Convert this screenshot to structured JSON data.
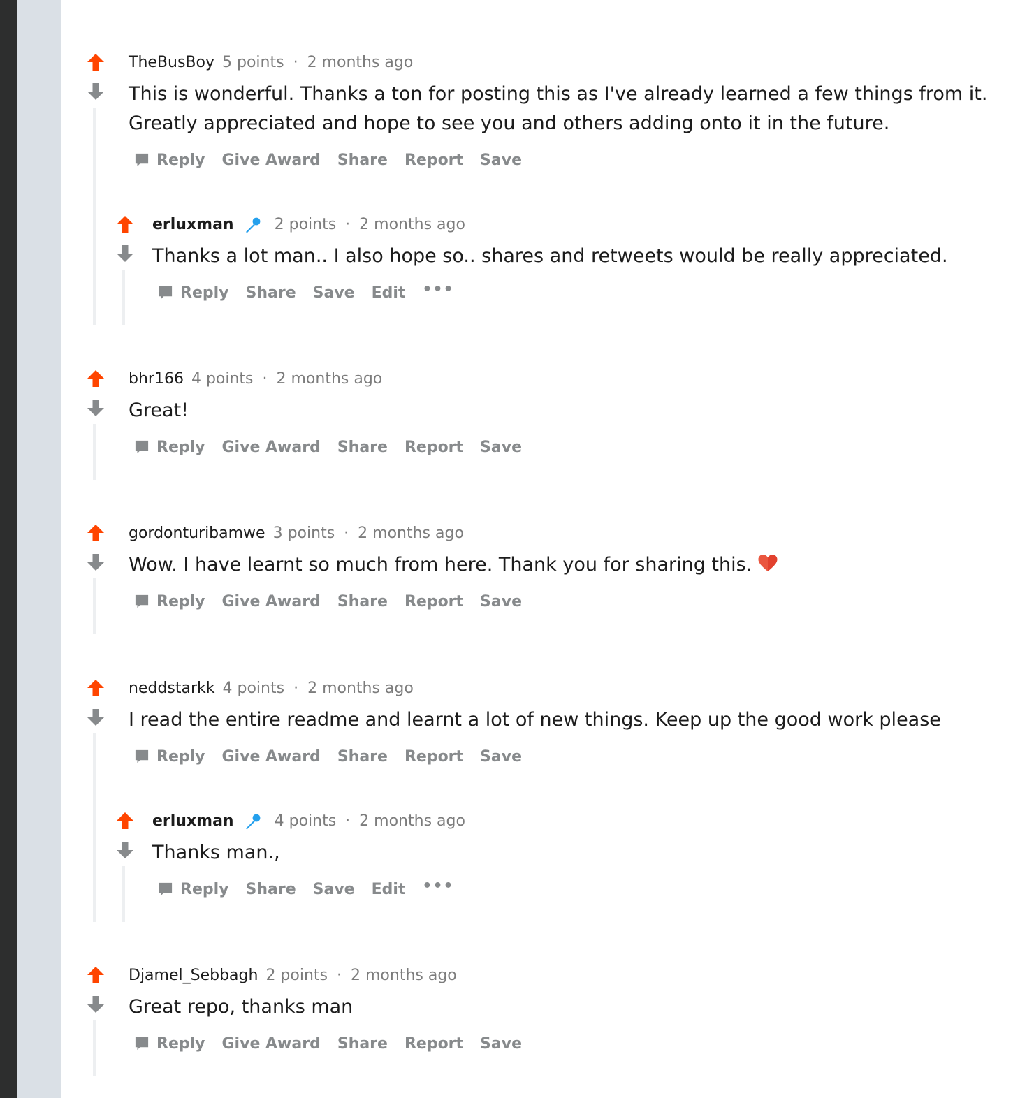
{
  "colors": {
    "upvote": "#ff4500",
    "downvote": "#878a8c",
    "mic_badge": "#24a0ed",
    "heart": "#e2412e",
    "meta_gray": "#7c7c7c",
    "action_gray": "#878a8c"
  },
  "comments": [
    {
      "author": "TheBusBoy",
      "points": "5 points",
      "separator": "·",
      "time": "2 months ago",
      "text": "This is wonderful. Thanks a ton for posting this as I've already learned a few things from it. Greatly appreciated and hope to see you and others adding onto it in the future.",
      "actions": [
        "Reply",
        "Give Award",
        "Share",
        "Report",
        "Save"
      ],
      "replies": [
        {
          "author": "erluxman",
          "is_op": true,
          "badge_icon": "microphone-icon",
          "points": "2 points",
          "separator": "·",
          "time": "2 months ago",
          "text": "Thanks a lot man.. I also hope so.. shares and retweets would be really appreciated.",
          "actions": [
            "Reply",
            "Share",
            "Save",
            "Edit"
          ],
          "more": "•••"
        }
      ]
    },
    {
      "author": "bhr166",
      "points": "4 points",
      "separator": "·",
      "time": "2 months ago",
      "text": "Great!",
      "actions": [
        "Reply",
        "Give Award",
        "Share",
        "Report",
        "Save"
      ]
    },
    {
      "author": "gordonturibamwe",
      "points": "3 points",
      "separator": "·",
      "time": "2 months ago",
      "text": "Wow. I have learnt so much from here. Thank you for sharing this.",
      "emoji_icon": "heart-icon",
      "actions": [
        "Reply",
        "Give Award",
        "Share",
        "Report",
        "Save"
      ]
    },
    {
      "author": "neddstarkk",
      "points": "4 points",
      "separator": "·",
      "time": "2 months ago",
      "text": "I read the entire readme and learnt a lot of new things. Keep up the good work please",
      "actions": [
        "Reply",
        "Give Award",
        "Share",
        "Report",
        "Save"
      ],
      "replies": [
        {
          "author": "erluxman",
          "is_op": true,
          "badge_icon": "microphone-icon",
          "points": "4 points",
          "separator": "·",
          "time": "2 months ago",
          "text": "Thanks man.,",
          "actions": [
            "Reply",
            "Share",
            "Save",
            "Edit"
          ],
          "more": "•••"
        }
      ]
    },
    {
      "author": "Djamel_Sebbagh",
      "points": "2 points",
      "separator": "·",
      "time": "2 months ago",
      "text": "Great repo, thanks man",
      "actions": [
        "Reply",
        "Give Award",
        "Share",
        "Report",
        "Save"
      ]
    }
  ]
}
